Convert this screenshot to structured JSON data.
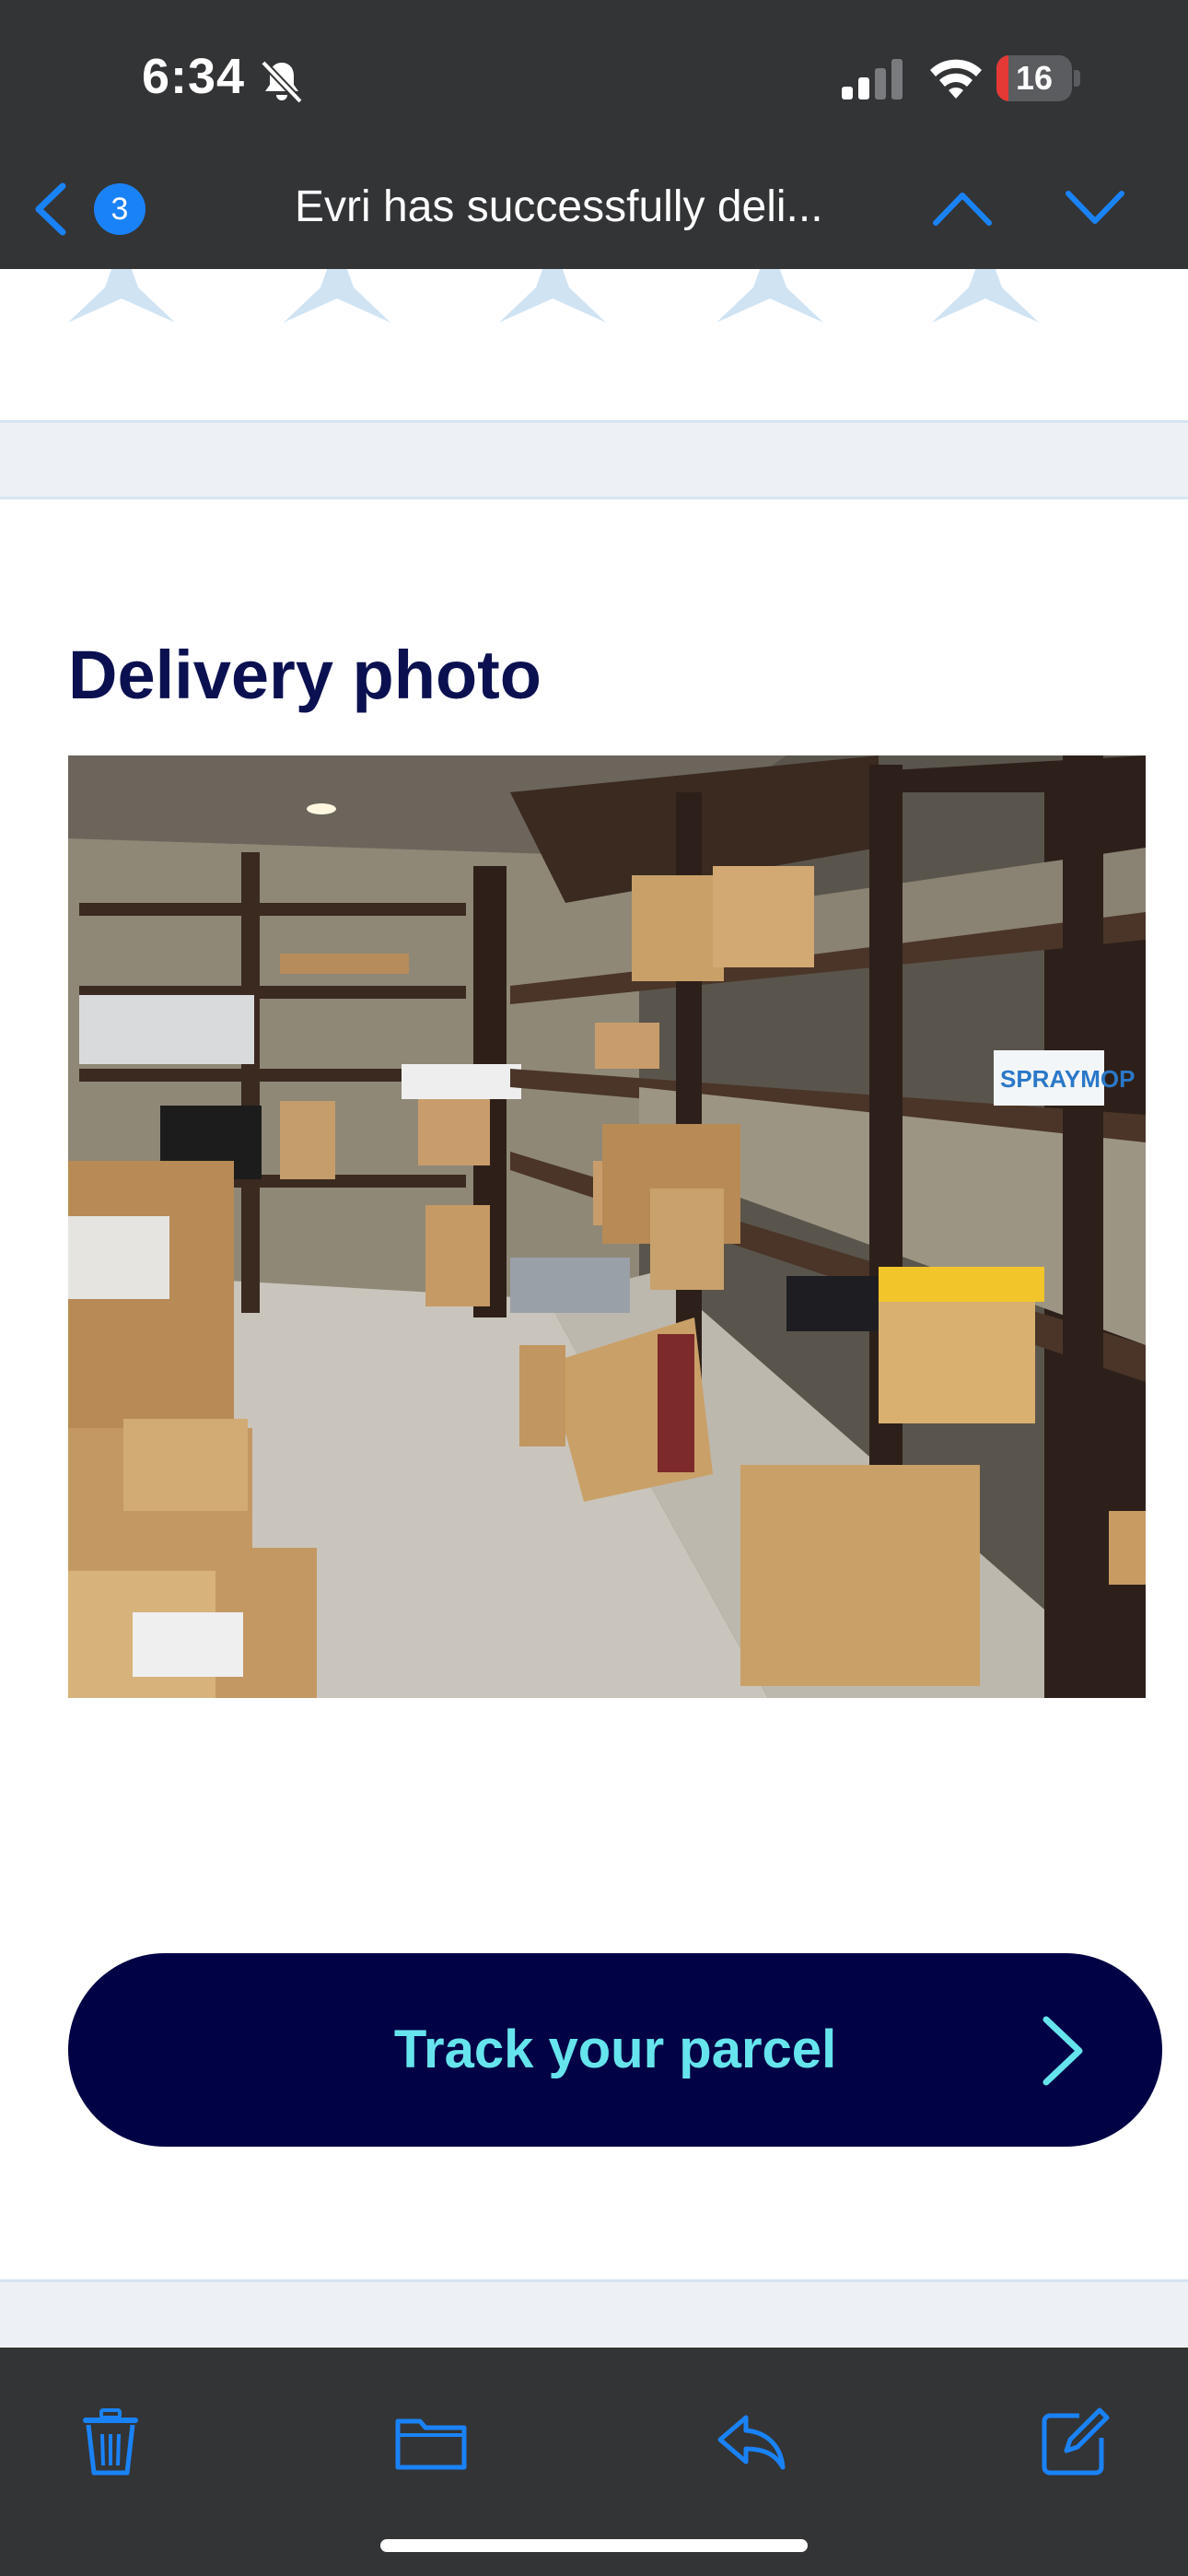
{
  "status_bar": {
    "time": "6:34",
    "battery_level": "16",
    "icons": [
      "bell-slash-icon",
      "cellular-signal-icon",
      "wifi-icon",
      "battery-icon"
    ]
  },
  "nav": {
    "unread_count": "3",
    "subject": "Evri has successfully deli...",
    "icons": [
      "chevron-left-icon",
      "chevron-up-icon",
      "chevron-down-icon"
    ]
  },
  "rating": {
    "star_count": 5,
    "star_color": "#cfe3f3"
  },
  "delivery": {
    "title": "Delivery photo",
    "photo_label_box": "SPRAYMOP"
  },
  "track_button": {
    "label": "Track your parcel",
    "icon": "chevron-right-icon"
  },
  "colors": {
    "chrome": "#333436",
    "accent_blue": "#1a82f7",
    "brand_navy": "#010145",
    "button_text": "#66e4ee",
    "title_navy": "#0b1150"
  },
  "toolbar": {
    "icons": [
      "trash-icon",
      "folder-icon",
      "reply-icon",
      "compose-icon"
    ]
  }
}
